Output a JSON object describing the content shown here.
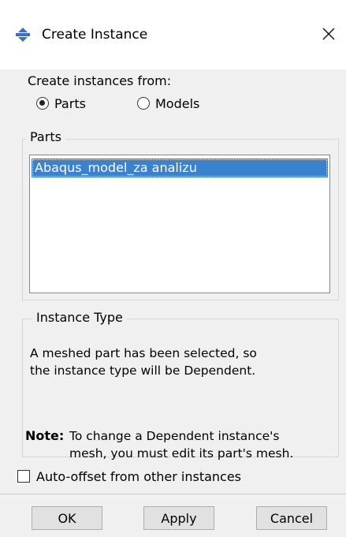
{
  "window": {
    "title": "Create Instance",
    "icon": "abaqus-instance-icon",
    "close_glyph": "✕"
  },
  "source": {
    "label": "Create instances from:",
    "options": [
      {
        "label": "Parts",
        "selected": true
      },
      {
        "label": "Models",
        "selected": false
      }
    ]
  },
  "parts": {
    "group_label": "Parts",
    "items": [
      {
        "label": "Abaqus_model_za analizu",
        "selected": true
      }
    ]
  },
  "instance_type": {
    "group_label": "Instance Type",
    "message_lines": [
      "A meshed part has been selected, so",
      "the instance type will be Dependent."
    ],
    "note_label": "Note:",
    "note_lines": [
      "To change a Dependent instance's",
      "mesh, you must edit its part's mesh."
    ]
  },
  "auto_offset": {
    "label": "Auto-offset from other instances",
    "checked": false
  },
  "buttons": {
    "ok": "OK",
    "apply": "Apply",
    "cancel": "Cancel"
  },
  "colors": {
    "selection": "#3a82d0",
    "dialog_bg": "#f0f0f0",
    "title_bg": "#ffffff"
  }
}
